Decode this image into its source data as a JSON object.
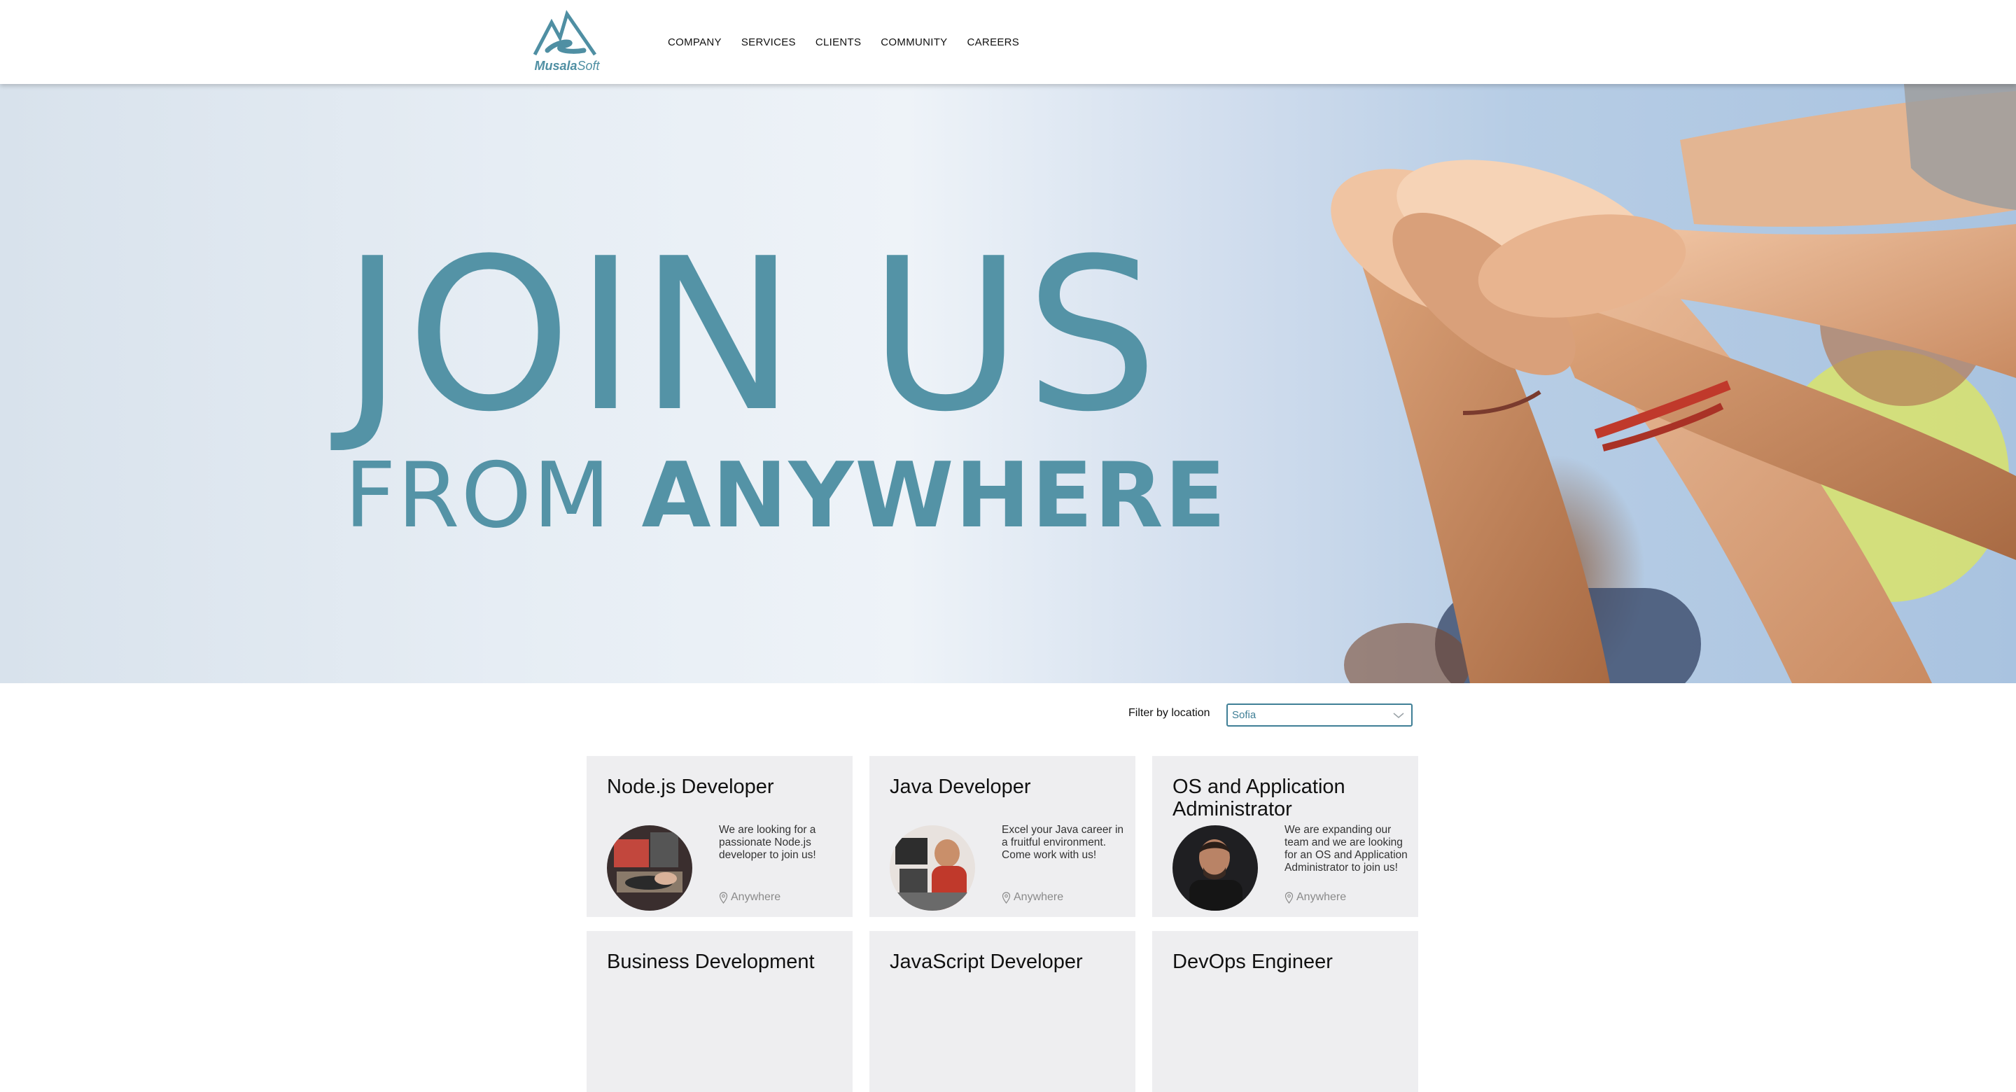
{
  "header": {
    "logo_text_bold": "Musala",
    "logo_text_light": "Soft",
    "nav": [
      "COMPANY",
      "SERVICES",
      "CLIENTS",
      "COMMUNITY",
      "CAREERS"
    ]
  },
  "hero": {
    "line1": "JOIN US",
    "line2_light": "FROM ",
    "line2_bold": "ANYWHERE",
    "text_color": "#5493a6"
  },
  "filter": {
    "label": "Filter by location",
    "value": "Sofia"
  },
  "jobs": [
    {
      "title": "Node.js Developer",
      "description": "We are looking for a passionate Node.js developer to join us!",
      "location": "Anywhere"
    },
    {
      "title": "Java Developer",
      "description": "Excel your Java career in a fruitful environment. Come work with us!",
      "location": "Anywhere"
    },
    {
      "title": "OS and Application Administrator",
      "description": "We are expanding our team and we are looking for an OS and Application Administrator to join us!",
      "location": "Anywhere"
    },
    {
      "title": "Business Development",
      "description": "",
      "location": ""
    },
    {
      "title": "JavaScript Developer",
      "description": "",
      "location": ""
    },
    {
      "title": "DevOps Engineer",
      "description": "",
      "location": ""
    }
  ],
  "colors": {
    "accent": "#3f7f96",
    "card_bg": "#eeeef0"
  }
}
